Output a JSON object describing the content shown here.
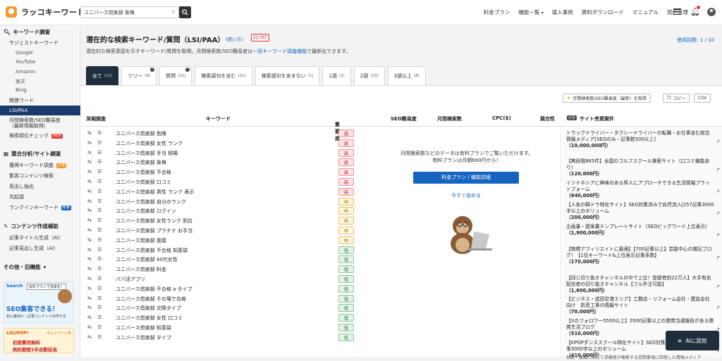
{
  "header": {
    "logo_text": "ラッコキーワード",
    "search_value": "ユニバース倶楽部 後悔",
    "nav": [
      "料金プラン",
      "機能一覧",
      "導入事例",
      "資料ダウンロード",
      "マニュアル",
      "契約管理"
    ]
  },
  "sidebar": {
    "sections": [
      {
        "title": "キーワード調査"
      },
      {
        "title": "競合分析/サイト調査"
      },
      {
        "title": "コンテンツ作成補助"
      },
      {
        "title": "その他・旧機能"
      }
    ],
    "kw": {
      "suggest": "サジェストキーワード",
      "sub": [
        "Google",
        "YouTube",
        "Amazon",
        "楽天",
        "Bing"
      ],
      "related": "関連ワード",
      "lsi": "LSI/PAA",
      "volume": "月間検索数/SEO難易度",
      "volume2": "（最新情報取得）",
      "rank": "検索順位チェック",
      "rank_badge": "NEW"
    },
    "comp": {
      "items": [
        "獲得キーワード調査",
        "集客コンテンツ検索",
        "見出し抽出",
        "共起語",
        "ランクインキーワード"
      ],
      "badge1": "人気",
      "badge2": "新着"
    },
    "content": {
      "items": [
        "記事タイトル生成（AI）",
        "記事見出し生成（AI）"
      ]
    },
    "promo1": {
      "search": "Search",
      "title": "有料プランで効率化！",
      "big": "SEO集客できる！",
      "sub": "初心者向け・記事コンテンツの作り方"
    },
    "promo2": {
      "brand": "LOLIPOP!",
      "campaign": "キャンペーン中",
      "line1": "初期費用無料",
      "line2": "契約期間1年自動延長"
    }
  },
  "main": {
    "title": "潜在的な検索キーワード/質問（LSI/PAA）",
    "usage_link": "使い方",
    "hit": "22",
    "hit_unit": "HIT",
    "usage_count": "使用回数: 1 / 10",
    "desc1": "潜在的な検索意図を示すキーワード/質問を取得。月間検索数/SEO難易度は",
    "desc_link": "一括キーワード調査機能",
    "desc2": "で最新化できます。",
    "tabs": [
      {
        "label": "全て",
        "count": "(22)"
      },
      {
        "label": "ツリー",
        "count": "(8)"
      },
      {
        "label": "質問",
        "count": "(11)"
      },
      {
        "label": "検索語句を含む",
        "count": "(21)"
      },
      {
        "label": "検索語句を含まない",
        "count": "(1)"
      },
      {
        "label": "1語",
        "count": "(1)"
      },
      {
        "label": "2語",
        "count": "(13)"
      },
      {
        "label": "3語以上",
        "count": "(8)"
      }
    ],
    "btn_fetch": "月間検索数/SEO難易度（最新）を取得",
    "btn_copy": "コピー",
    "btn_csv": "CSV",
    "cols": {
      "deep": "深堀調査",
      "kw": "キーワード",
      "imp": "重要度",
      "seo": "SEO難易度",
      "vol": "月間検索数",
      "cpc": "CPC($)",
      "comp": "競合性",
      "ad_tag": "広告",
      "sale": "サイト売買案件"
    },
    "rows": [
      {
        "kw": "ユニバース倶楽部 危険",
        "imp": "高",
        "lvl": "h"
      },
      {
        "kw": "ユニバース倶楽部 女性 ランク",
        "imp": "高",
        "lvl": "h"
      },
      {
        "kw": "ユニバース倶楽部 手当 相場",
        "imp": "高",
        "lvl": "h"
      },
      {
        "kw": "ユニバース倶楽部 後悔",
        "imp": "高",
        "lvl": "h"
      },
      {
        "kw": "ユニバース倶楽部 不合格",
        "imp": "高",
        "lvl": "h"
      },
      {
        "kw": "ユニバース倶楽部 口コミ",
        "imp": "高",
        "lvl": "h"
      },
      {
        "kw": "ユニバース倶楽部 男性 ランク 表示",
        "imp": "高",
        "lvl": "h"
      },
      {
        "kw": "ユニバース倶楽部 自分のランク",
        "imp": "中",
        "lvl": "m"
      },
      {
        "kw": "ユニバース倶楽部 ログイン",
        "imp": "中",
        "lvl": "m"
      },
      {
        "kw": "ユニバース倶楽部 女性ランク 割合",
        "imp": "中",
        "lvl": "m"
      },
      {
        "kw": "ユニバース倶楽部 プラチナ お手当",
        "imp": "中",
        "lvl": "m"
      },
      {
        "kw": "ユニバース倶楽部 面接",
        "imp": "中",
        "lvl": "m"
      },
      {
        "kw": "ユニバース倶楽部 不合格 知恵袋",
        "imp": "低",
        "lvl": "l"
      },
      {
        "kw": "ユニバース倶楽部 40代女性",
        "imp": "低",
        "lvl": "l"
      },
      {
        "kw": "ユニバース倶楽部 料金",
        "imp": "低",
        "lvl": "l"
      },
      {
        "kw": "パパ活アプリ",
        "imp": "低",
        "lvl": "l"
      },
      {
        "kw": "ユニバース倶楽部 不合格 a タイプ",
        "imp": "低",
        "lvl": "l"
      },
      {
        "kw": "ユニバース倶楽部 その場で合格",
        "imp": "低",
        "lvl": "l"
      },
      {
        "kw": "ユニバース倶楽部 交際タイプ",
        "imp": "低",
        "lvl": "l"
      },
      {
        "kw": "ユニバース倶楽部 女性 口コミ",
        "imp": "低",
        "lvl": "l"
      },
      {
        "kw": "ユニバース倶楽部 知恵袋",
        "imp": "低",
        "lvl": "l"
      },
      {
        "kw": "ユニバース倶楽部 タイプ",
        "imp": "低",
        "lvl": "l"
      }
    ],
    "locked": {
      "line1": "月間検索数などのデータは有料プランでご覧いただけます。",
      "line2": "有料プランは月額660円から！",
      "button": "料金プラン / 機能詳細",
      "link": "今すぐ始める"
    },
    "sales": [
      {
        "text": "トラックドライバー・タクシードライバーの転職・お仕事含む総合情報メディア[SEOのみ・記事数500以上]",
        "price": "（10,000,000円）"
      },
      {
        "text": "【無段階865件】全国のゴルフスクール検索サイト（口コミ機能あり）",
        "price": "（120,000円）"
      },
      {
        "text": "インドネシアに興味のある邦人にアプローチできる生活情報プラットフォーム",
        "price": "（640,000円）"
      },
      {
        "text": "【人気の韓ドラ特化サイト】SEO対策済みで自然流入|257記事3000字以上のボリューム",
        "price": "（200,000円）"
      },
      {
        "text": "企画書・提案書テンプレートサイト（SEOビッグワード上位表示）",
        "price": "（1,900,000円）"
      },
      {
        "text": "【物標アフィリエイトに最適】【700記事以上】芸能中心の雑記ブログ！【1位キーワード&上位表示記事多数】",
        "price": "（170,000円）"
      },
      {
        "text": "【同じ切り抜きチャンネルの中で上位！登録者約22万人】大手有名配信者の切り抜きチャンネル【フル外注可能】",
        "price": "（1,800,000円）"
      },
      {
        "text": "【ビジネス・成田空港エリア】工務店・リフォーム会社・建設会社向け　防音工事の情報サイト",
        "price": "（70,000円）"
      },
      {
        "text": "【Xのフォロワー5500以上】2000記事以上の懸賞当選報告がある懸賞生活ブログ",
        "price": "（510,000円）"
      },
      {
        "text": "【KPOPダンススクール特化サイト】SEO対策済みで自然流入|68記事3000字以上のボリューム",
        "price": "（410,000円）"
      }
    ],
    "sale_more": "就職・転職に関して求職者が検索する質問事項に回答した情報メディア",
    "ai_button": "AIに質問"
  }
}
